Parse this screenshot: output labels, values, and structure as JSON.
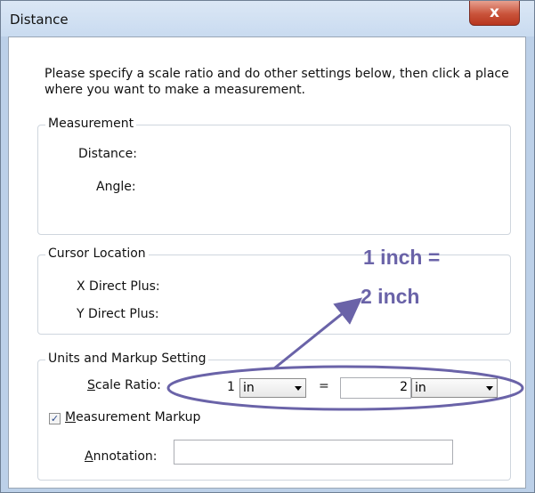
{
  "window": {
    "title": "Distance",
    "close_glyph": "x"
  },
  "instruction": "Please specify a scale ratio and do other settings below, then click a place where you want to make a measurement.",
  "measurement": {
    "legend": "Measurement",
    "distance_label": "Distance:",
    "angle_label": "Angle:"
  },
  "cursor_location": {
    "legend": "Cursor Location",
    "x_label": "X Direct Plus:",
    "y_label": "Y Direct Plus:"
  },
  "units": {
    "legend": "Units and Markup Setting",
    "scale_ratio_mnemonic": "S",
    "scale_ratio_rest": "cale Ratio:",
    "left_value": "1",
    "left_unit": "in",
    "equals": "=",
    "right_value": "2",
    "right_unit": "in",
    "markup_checked": true,
    "markup_mnemonic": "M",
    "markup_rest": "easurement Markup",
    "annotation_mnemonic": "A",
    "annotation_rest": "nnotation:",
    "annotation_value": ""
  },
  "callout": {
    "line1": "1 inch =",
    "line2": "2 inch",
    "color": "#6a63a8"
  }
}
